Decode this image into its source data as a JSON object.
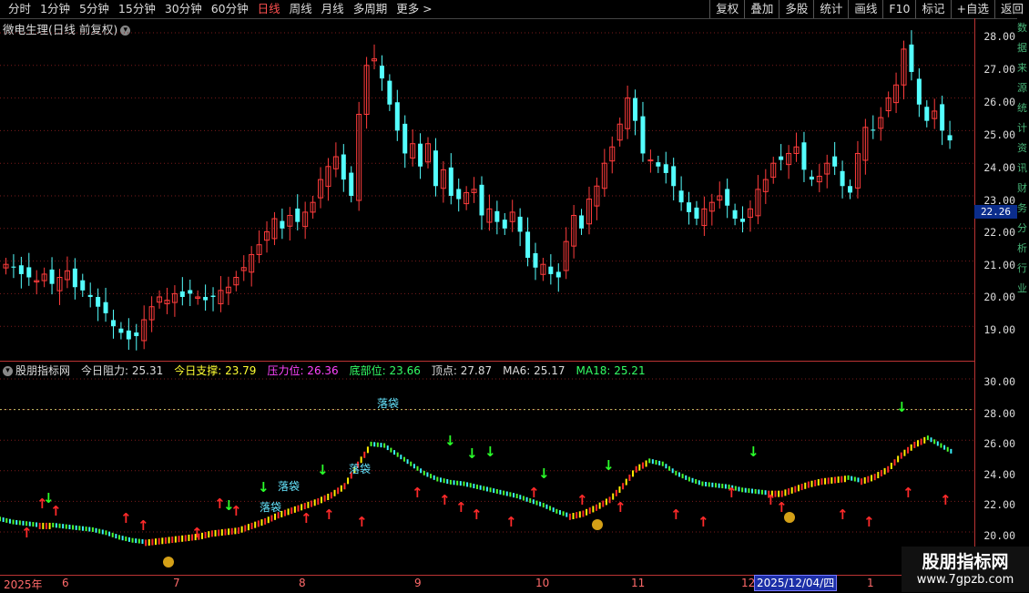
{
  "toolbar": {
    "periods": [
      "分时",
      "1分钟",
      "5分钟",
      "15分钟",
      "30分钟",
      "60分钟",
      "日线",
      "周线",
      "月线",
      "多周期",
      "更多 >"
    ],
    "active_period": "日线",
    "buttons": [
      "复权",
      "叠加",
      "多股",
      "统计",
      "画线",
      "F10",
      "标记",
      "+自选",
      "返回"
    ]
  },
  "main_chart": {
    "title": "微电生理(日线 前复权)",
    "price_axis": [
      "28.00",
      "27.00",
      "26.00",
      "25.00",
      "24.00",
      "23.00",
      "22.00",
      "21.00",
      "20.00",
      "19.00"
    ],
    "current_price": "22.26"
  },
  "indicator": {
    "name": "股朋指标网",
    "stats": [
      {
        "label": "今日阻力:",
        "value": "25.31",
        "color": "#dddddd"
      },
      {
        "label": "今日支撑:",
        "value": "23.79",
        "color": "#ffff33"
      },
      {
        "label": "压力位:",
        "value": "26.36",
        "color": "#ff44ff"
      },
      {
        "label": "底部位:",
        "value": "23.66",
        "color": "#33ff66"
      },
      {
        "label": "顶点:",
        "value": "27.87",
        "color": "#dddddd"
      },
      {
        "label": "MA6:",
        "value": "25.17",
        "color": "#dddddd"
      },
      {
        "label": "MA18:",
        "value": "25.21",
        "color": "#33ff66"
      }
    ],
    "axis": [
      "30.00",
      "28.00",
      "26.00",
      "24.00",
      "22.00",
      "20.00"
    ],
    "annotations": [
      "落袋",
      "落袋",
      "落袋",
      "落袋"
    ]
  },
  "chart_data": {
    "type": "candlestick",
    "series": [
      {
        "name": "price",
        "values": [
          20.9,
          20.8,
          20.6,
          20.5,
          20.4,
          20.6,
          20.3,
          20.5,
          20.7,
          20.2,
          20.1,
          19.9,
          19.6,
          19.4,
          19.0,
          18.8,
          18.6,
          18.7,
          19.2,
          19.6,
          19.9,
          19.8,
          20.0,
          19.9,
          20.0,
          19.9,
          19.8,
          19.9,
          20.1,
          20.2,
          20.5,
          20.8,
          21.2,
          21.5,
          21.9,
          22.3,
          22.0,
          22.4,
          22.2,
          22.5,
          22.8,
          23.5,
          23.9,
          24.2,
          23.5,
          23.0,
          25.5,
          27.0,
          27.2,
          26.6,
          25.8,
          25.0,
          24.3,
          24.6,
          23.9,
          24.6,
          23.3,
          23.8,
          23.0,
          22.9,
          23.1,
          23.2,
          22.4,
          22.6,
          22.2,
          22.0,
          22.5,
          21.9,
          21.1,
          20.8,
          20.9,
          20.6,
          20.5,
          21.6,
          22.4,
          22.0,
          22.9,
          23.3,
          24.0,
          24.5,
          25.2,
          26.0,
          25.3,
          24.3,
          24.1,
          23.9,
          23.7,
          23.3,
          22.8,
          22.5,
          22.3,
          22.6,
          22.8,
          23.0,
          22.7,
          22.3,
          22.2,
          22.6,
          23.2,
          23.5,
          24.0,
          24.1,
          24.3,
          24.5,
          23.8,
          23.5,
          23.6,
          24.0,
          23.9,
          23.3,
          23.1,
          24.3,
          25.1,
          25.0,
          25.4,
          26.0,
          26.4,
          27.5,
          26.8,
          25.8,
          25.3,
          25.6,
          25.0,
          24.7
        ]
      },
      {
        "name": "indicator",
        "values": [
          21.0,
          20.8,
          20.7,
          20.6,
          20.6,
          20.5,
          20.4,
          20.3,
          20.1,
          19.8,
          19.6,
          19.5,
          19.6,
          19.7,
          19.8,
          19.9,
          20.1,
          20.2,
          20.3,
          20.6,
          20.9,
          21.3,
          21.6,
          21.9,
          22.2,
          22.6,
          23.2,
          24.6,
          25.9,
          25.8,
          25.2,
          24.6,
          24.0,
          23.6,
          23.4,
          23.3,
          23.1,
          22.9,
          22.7,
          22.5,
          22.2,
          21.9,
          21.5,
          21.2,
          21.4,
          21.8,
          22.3,
          23.2,
          24.3,
          24.8,
          24.6,
          24.0,
          23.6,
          23.3,
          23.2,
          23.1,
          22.9,
          22.8,
          22.7,
          22.7,
          23.0,
          23.3,
          23.5,
          23.6,
          23.7,
          23.5,
          23.8,
          24.3,
          25.2,
          25.9,
          26.3,
          25.8,
          25.3
        ]
      }
    ]
  }
}
